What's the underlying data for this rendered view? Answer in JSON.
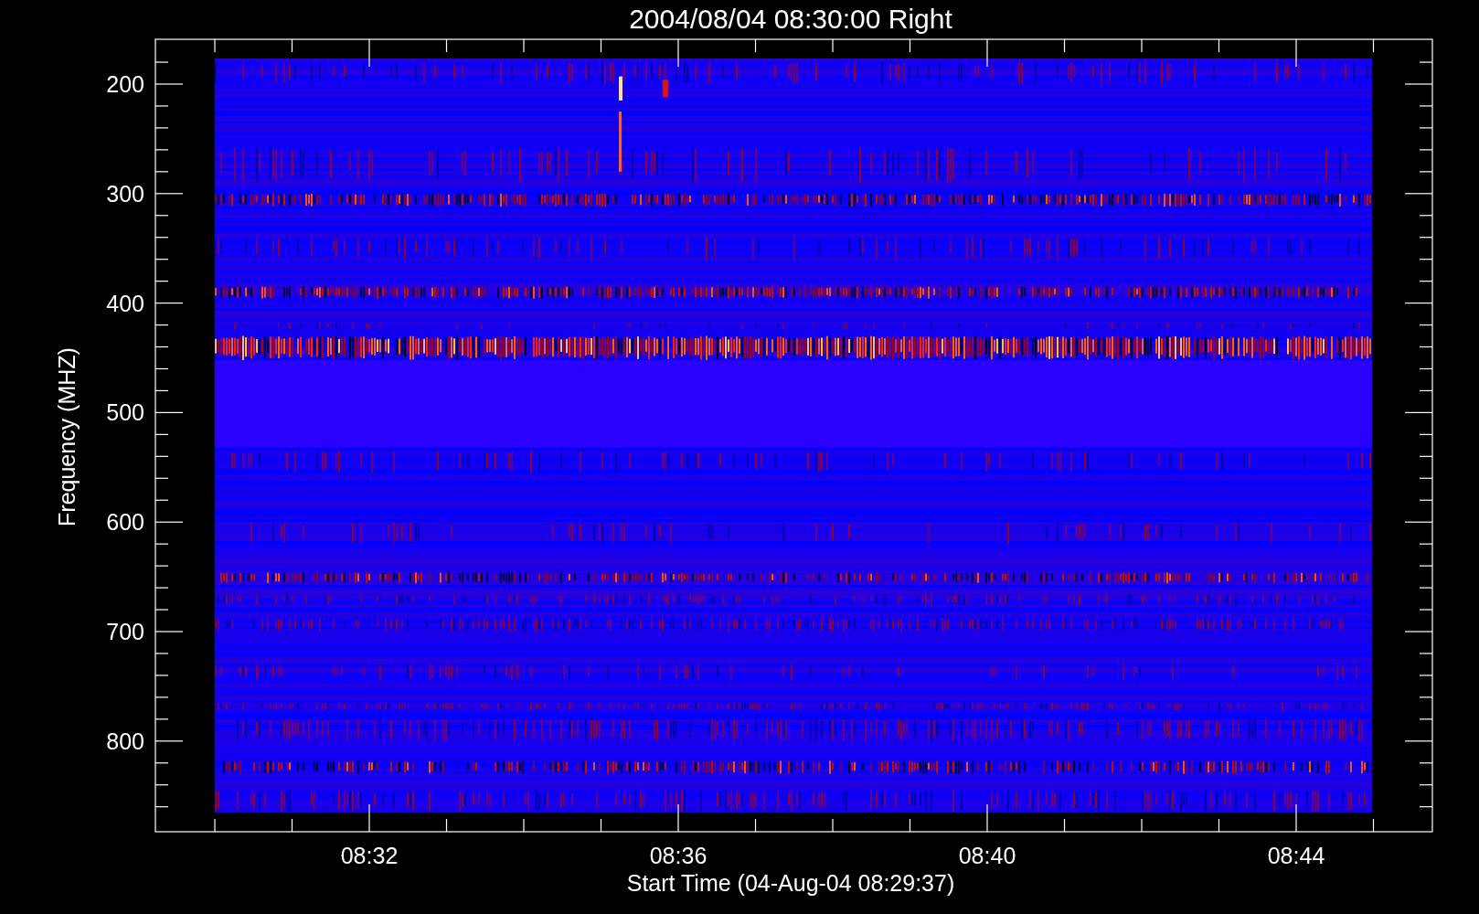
{
  "title": "2004/08/04 08:30:00 Right",
  "plot": {
    "ylabel": "Frequency (MHZ)",
    "xlabel": "Start Time (04-Aug-04 08:29:37)",
    "yticks": [
      "200",
      "300",
      "400",
      "500",
      "600",
      "700",
      "800"
    ],
    "xticks": [
      "08:32",
      "08:36",
      "08:40",
      "08:44"
    ]
  }
}
